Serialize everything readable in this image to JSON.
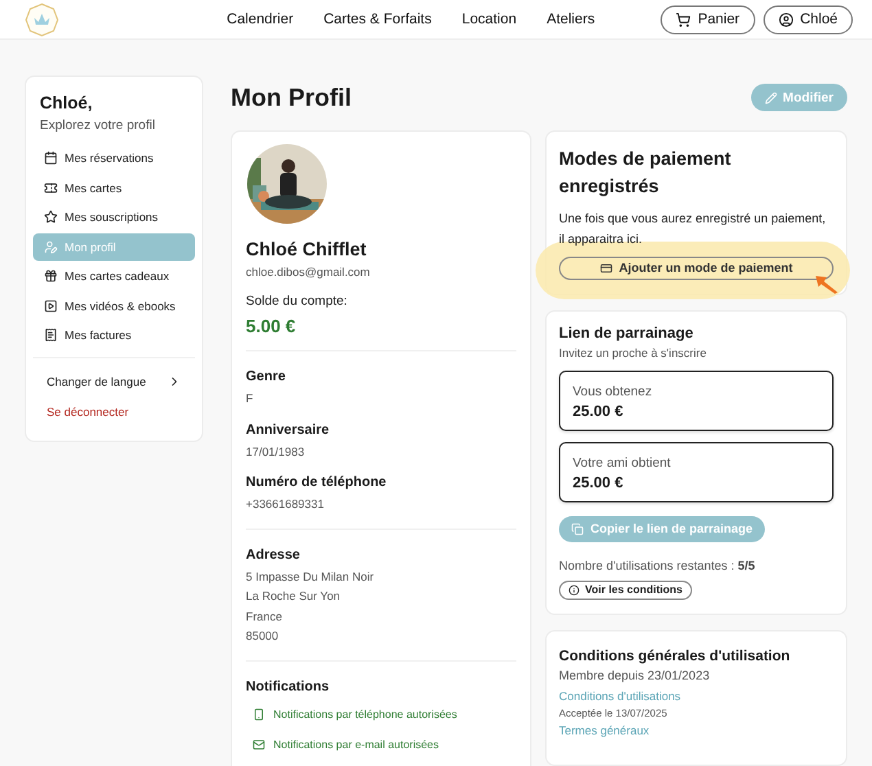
{
  "nav": {
    "links": [
      "Calendrier",
      "Cartes & Forfaits",
      "Location",
      "Ateliers"
    ],
    "cart_button": "Panier",
    "account_button": "Chloé"
  },
  "sidebar": {
    "greeting": "Chloé,",
    "subtitle": "Explorez votre profil",
    "items": [
      {
        "label": "Mes réservations",
        "selected": false
      },
      {
        "label": "Mes cartes",
        "selected": false
      },
      {
        "label": "Mes souscriptions",
        "selected": false
      },
      {
        "label": "Mon profil",
        "selected": true
      },
      {
        "label": "Mes cartes cadeaux",
        "selected": false
      },
      {
        "label": "Mes vidéos & ebooks",
        "selected": false
      },
      {
        "label": "Mes factures",
        "selected": false
      }
    ],
    "language": "Changer de langue",
    "logout": "Se déconnecter"
  },
  "page_title": "Mon Profil",
  "edit_button": "Modifier",
  "profile": {
    "name": "Chloé Chifflet",
    "email": "chloe.dibos@gmail.com",
    "balance_label": "Solde du compte:",
    "balance": "5.00 €",
    "fields": [
      {
        "label": "Genre",
        "lines": [
          "F"
        ]
      },
      {
        "label": "Anniversaire",
        "lines": [
          "17/01/1983"
        ]
      },
      {
        "label": "Numéro de téléphone",
        "lines": [
          "+33661689331"
        ]
      },
      {
        "label": "Adresse",
        "lines": [
          "5 Impasse Du Milan Noir",
          "La Roche Sur Yon",
          "France",
          "85000"
        ]
      }
    ],
    "notifications_title": "Notifications",
    "notifications": [
      {
        "kind": "phone",
        "label": "Notifications par téléphone autorisées"
      },
      {
        "kind": "email",
        "label": "Notifications par e-mail autorisées"
      }
    ]
  },
  "payment": {
    "title": "Modes de paiement enregistrés",
    "text": "Une fois que vous aurez enregistré un paiement, il apparaitra ici.",
    "button": "Ajouter un mode de paiement",
    "highlighted": true
  },
  "referral": {
    "title": "Lien de parrainage",
    "subtitle": "Invitez un proche à s'inscrire",
    "rewards": [
      {
        "label": "Vous obtenez",
        "amount": "25.00 €"
      },
      {
        "label": "Votre ami obtient",
        "amount": "25.00 €"
      }
    ],
    "copy_button": "Copier le lien de parrainage",
    "uses_label": "Nombre d'utilisations restantes :",
    "uses_value": "5/5",
    "conditions_button": "Voir les conditions"
  },
  "terms": {
    "title": "Conditions générales d'utilisation",
    "member_since": "Membre depuis 23/01/2023",
    "documents": [
      {
        "link": "Conditions d'utilisations",
        "accepted": "Acceptée le 13/07/2025"
      },
      {
        "link": "Termes généraux"
      }
    ]
  }
}
